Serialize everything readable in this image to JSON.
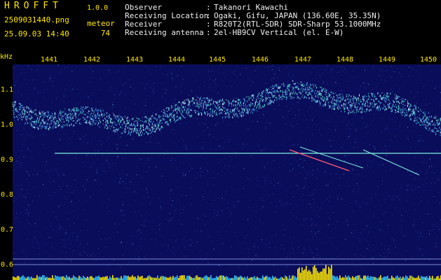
{
  "header": {
    "app_title": "HROFFT",
    "app_version": "1.0.0",
    "file_name": "2509031440.png",
    "timestamp": "25.09.03 14:40",
    "detect_label": "meteor",
    "detect_count": "74"
  },
  "station": [
    {
      "key": "Observer",
      "value": "Takanori Kawachi"
    },
    {
      "key": "Receiving Location",
      "value": "Ogaki, Gifu, JAPAN (136.60E, 35.35N)"
    },
    {
      "key": "Receiver",
      "value": "R820T2(RTL-SDR) SDR-Sharp 53.1000MHz"
    },
    {
      "key": "Receiving antenna",
      "value": "2el-HB9CV Vertical (el. E-W)"
    }
  ],
  "axis": {
    "y_unit": "kHz",
    "y_ticks": [
      "1.1",
      "1.0",
      "0.9",
      "0.8",
      "0.7",
      "0.6"
    ],
    "x_ticks": [
      "1441",
      "1442",
      "1443",
      "1444",
      "1445",
      "1446",
      "1447",
      "1448",
      "1449",
      "1450"
    ]
  },
  "colors": {
    "background": "#0a0d5a",
    "label": "#ffe800",
    "echo": "#7ef0e0",
    "meteor": "#ff5a78"
  }
}
